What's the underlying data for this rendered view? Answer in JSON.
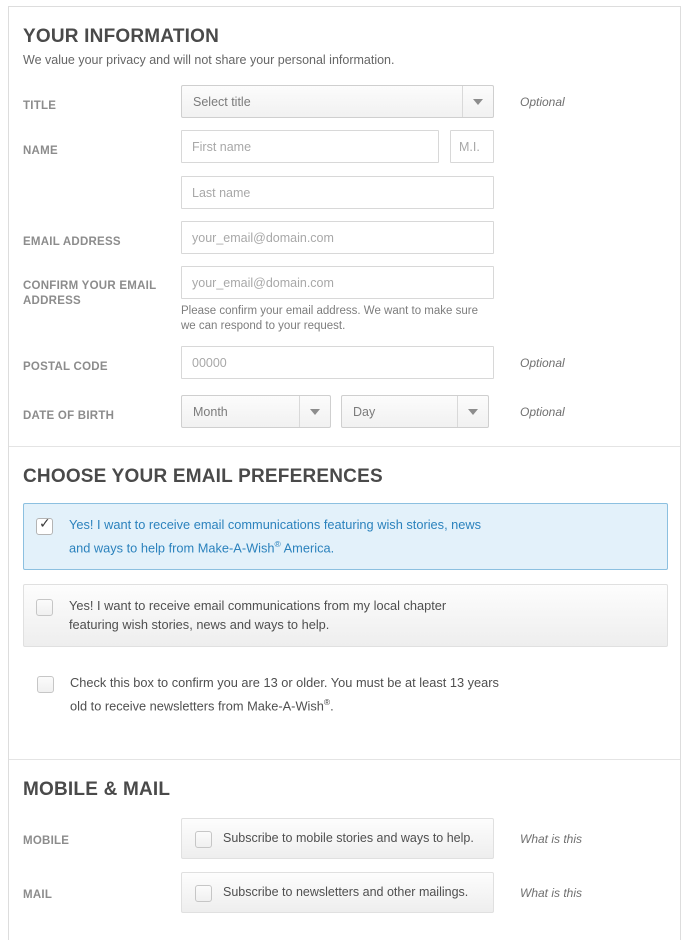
{
  "sections": {
    "your_information": {
      "title": "YOUR INFORMATION",
      "subtitle": "We value your privacy and will not share your personal information.",
      "optional_label": "Optional",
      "fields": {
        "title": {
          "label": "TITLE",
          "select_value": "Select title",
          "note": "Optional"
        },
        "name": {
          "label": "NAME",
          "first_placeholder": "First name",
          "mi_placeholder": "M.I.",
          "last_placeholder": "Last name"
        },
        "email": {
          "label": "EMAIL ADDRESS",
          "placeholder": "your_email@domain.com"
        },
        "confirm_email": {
          "label": "CONFIRM YOUR EMAIL ADDRESS",
          "placeholder": "your_email@domain.com",
          "help": "Please confirm your email address. We want to make sure we can respond to your request."
        },
        "postal_code": {
          "label": "POSTAL CODE",
          "placeholder": "00000",
          "note": "Optional"
        },
        "date_of_birth": {
          "label": "DATE OF BIRTH",
          "month_value": "Month",
          "day_value": "Day",
          "note": "Optional"
        }
      }
    },
    "email_preferences": {
      "title": "CHOOSE YOUR EMAIL PREFERENCES",
      "options": [
        {
          "checked": true,
          "style": "selected",
          "text_before": "Yes! I want to receive email communications featuring wish stories, news and ways to help from Make-A-Wish",
          "superscript": "®",
          "text_after": " America."
        },
        {
          "checked": false,
          "style": "plain",
          "text_before": "Yes! I want to receive email communications from my local chapter featuring wish stories, news and ways to help.",
          "superscript": "",
          "text_after": ""
        },
        {
          "checked": false,
          "style": "bare",
          "text_before": "Check this box to confirm you are 13 or older. You must be at least 13 years old to receive newsletters from Make-A-Wish",
          "superscript": "®",
          "text_after": "."
        }
      ]
    },
    "mobile_mail": {
      "title": "MOBILE & MAIL",
      "rows": [
        {
          "label": "MOBILE",
          "checkbox_text": "Subscribe to mobile stories and ways to help.",
          "link": "What is this",
          "checked": false
        },
        {
          "label": "MAIL",
          "checkbox_text": "Subscribe to newsletters and other mailings.",
          "link": "What is this",
          "checked": false
        }
      ]
    }
  },
  "icons": {
    "check": "✓",
    "caret_down": "chevron-down-icon"
  },
  "colors": {
    "accent_blue": "#2b82bd",
    "selected_bg": "#e3f1fa",
    "selected_border": "#8cc0e0",
    "label_grey": "#8c8c8c",
    "heading_grey": "#4a4a4a",
    "border_grey": "#d8d8d8"
  }
}
